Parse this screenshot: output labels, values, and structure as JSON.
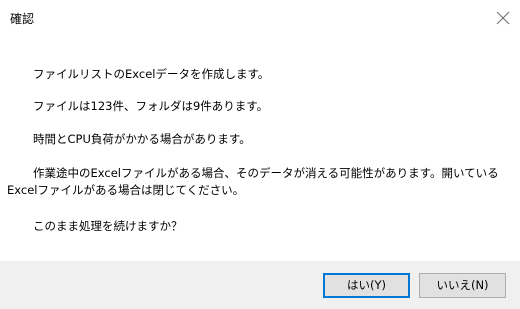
{
  "window": {
    "title": "確認"
  },
  "message": {
    "line1": "ファイルリストのExcelデータを作成します。",
    "line2": "ファイルは123件、フォルダは9件あります。",
    "line3": "時間とCPU負荷がかかる場合があります。",
    "line4": "作業途中のExcelファイルがある場合、そのデータが消える可能性があります。開いているExcelファイルがある場合は閉じてください。",
    "line5": "このまま処理を続けますか？"
  },
  "buttons": {
    "yes_label": "はい(Y)",
    "no_label": "いいえ(N)"
  },
  "icons": {
    "close": "close-icon"
  },
  "colors": {
    "accent": "#0078d7",
    "footer_bg": "#f0f0f0",
    "button_bg": "#e1e1e1"
  }
}
